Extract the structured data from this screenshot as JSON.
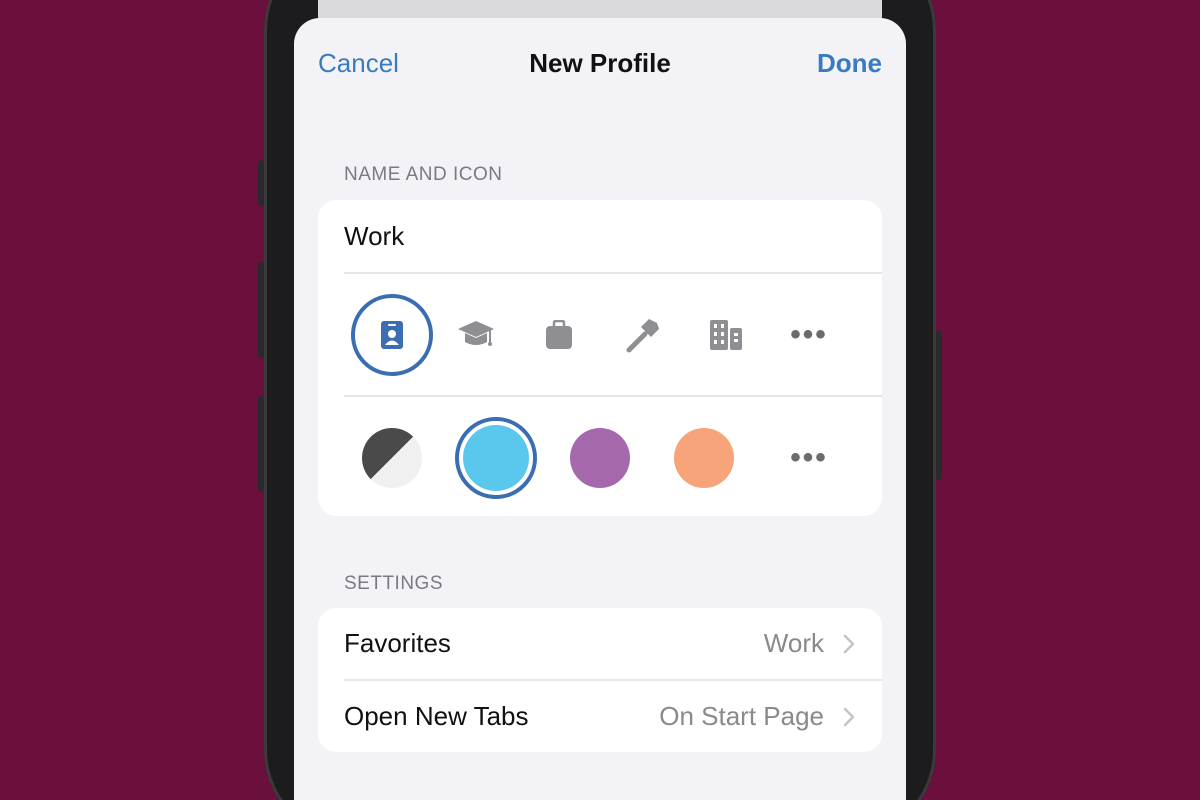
{
  "nav": {
    "cancel": "Cancel",
    "title": "New Profile",
    "done": "Done"
  },
  "name_section": {
    "header": "NAME AND ICON",
    "name_value": "Work",
    "icons": [
      "id-badge-icon",
      "graduation-cap-icon",
      "briefcase-icon",
      "hammer-icon",
      "building-icon",
      "more-icon"
    ],
    "selected_icon": "id-badge-icon",
    "more": "•••",
    "colors": [
      "#4a4a4a/#f0f0f0",
      "#5ac8ec",
      "#a668ad",
      "#f7a47a"
    ],
    "selected_color": "#5ac8ec"
  },
  "settings_section": {
    "header": "SETTINGS",
    "rows": [
      {
        "label": "Favorites",
        "value": "Work"
      },
      {
        "label": "Open New Tabs",
        "value": "On Start Page"
      }
    ]
  },
  "colors": {
    "background": "#6b0f3c",
    "accent": "#3a7bbf"
  }
}
